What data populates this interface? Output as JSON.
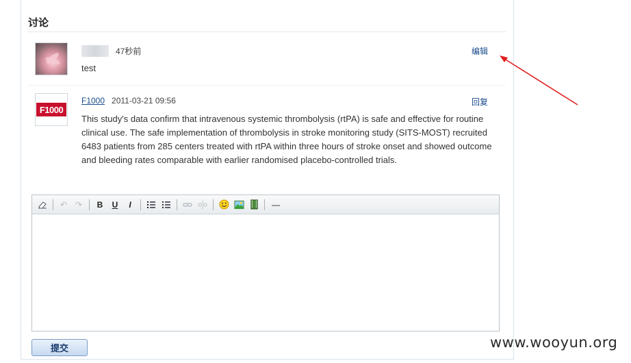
{
  "discussion": {
    "title": "讨论",
    "comments": [
      {
        "author": "",
        "time": "47秒前",
        "action": "编辑",
        "text": "test"
      },
      {
        "author": "F1000",
        "logo_text": "F1000",
        "time": "2011-03-21 09:56",
        "action": "回复",
        "text": "This study's data confirm that intravenous systemic thrombolysis (rtPA) is safe and effective for routine clinical use. The safe implementation of thrombolysis in stroke monitoring study (SITS-MOST) recruited 6483 patients from 285 centers treated with rtPA within three hours of stroke onset and showed outcome and bleeding rates comparable with earlier randomised placebo-controlled trials."
      }
    ]
  },
  "editor": {
    "toolbar": {
      "bold": "B",
      "underline": "U",
      "italic": "I",
      "hr": "—"
    },
    "submit_label": "提交"
  },
  "watermark": "www.wooyun.org",
  "colors": {
    "link": "#1a4c8c",
    "annotation_arrow": "#e02020"
  }
}
